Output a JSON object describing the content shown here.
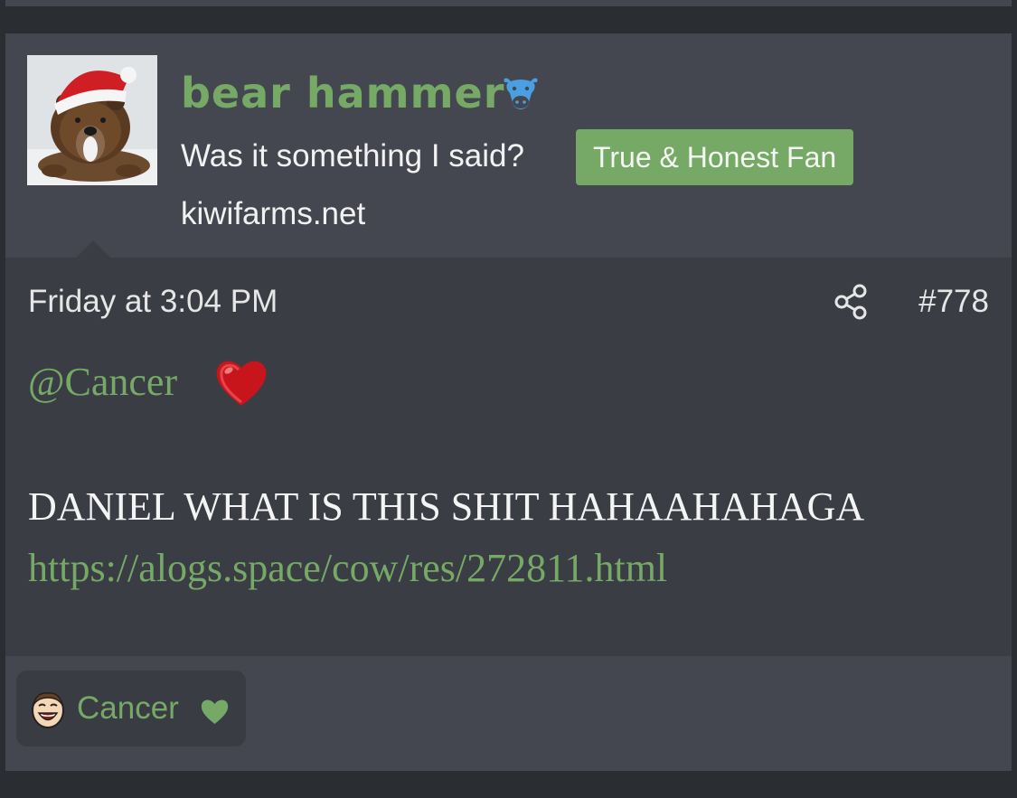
{
  "post": {
    "author": {
      "username": "bear hammer",
      "user_title": "Was it something I said?",
      "banner": "True & Honest Fan",
      "site": "kiwifarms.net",
      "avatar_icon": "bear-in-santa-hat",
      "badge_icon": "cow-icon"
    },
    "timestamp": "Friday at 3:04 PM",
    "post_number": "#778",
    "share_icon": "share-icon",
    "body": {
      "mention": "@Cancer",
      "mention_emoji": "red-heart-emoji",
      "text": "DANIEL WHAT IS THIS SHIT HAHAAHAHAGA",
      "link": "https://alogs.space/cow/res/272811.html"
    },
    "reactions": [
      {
        "user": "Cancer",
        "icon": "laughing-face-icon",
        "reaction": "heart-icon"
      }
    ]
  },
  "colors": {
    "accent_green": "#76a866",
    "page_background": "#2a2d32",
    "header_background": "#44474f",
    "post_background": "#3a3d44"
  }
}
